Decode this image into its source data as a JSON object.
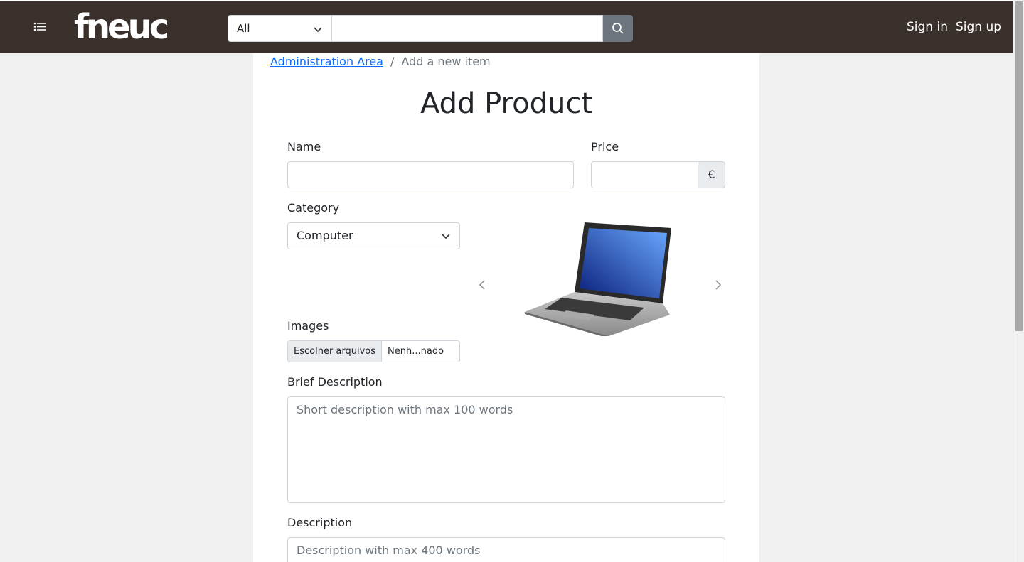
{
  "header": {
    "logo_text": "fneuc",
    "search_category": "All",
    "search_value": "",
    "signin_label": "Sign in",
    "signup_label": "Sign up"
  },
  "breadcrumb": {
    "parent": "Administration Area",
    "separator": "/",
    "current": "Add a new item"
  },
  "page": {
    "title": "Add Product"
  },
  "form": {
    "name_label": "Name",
    "name_value": "",
    "price_label": "Price",
    "price_value": "",
    "currency_symbol": "€",
    "category_label": "Category",
    "category_value": "Computer",
    "images_label": "Images",
    "file_button": "Escolher arquivos",
    "file_status": "Nenh...nado",
    "brief_label": "Brief Description",
    "brief_placeholder": "Short description with max 100 words",
    "description_label": "Description",
    "description_placeholder": "Description with max 400 words"
  },
  "colors": {
    "navbar": "#3a302b",
    "search_button": "#6c757d",
    "link": "#0d6efd",
    "background": "#f0f0f0"
  }
}
